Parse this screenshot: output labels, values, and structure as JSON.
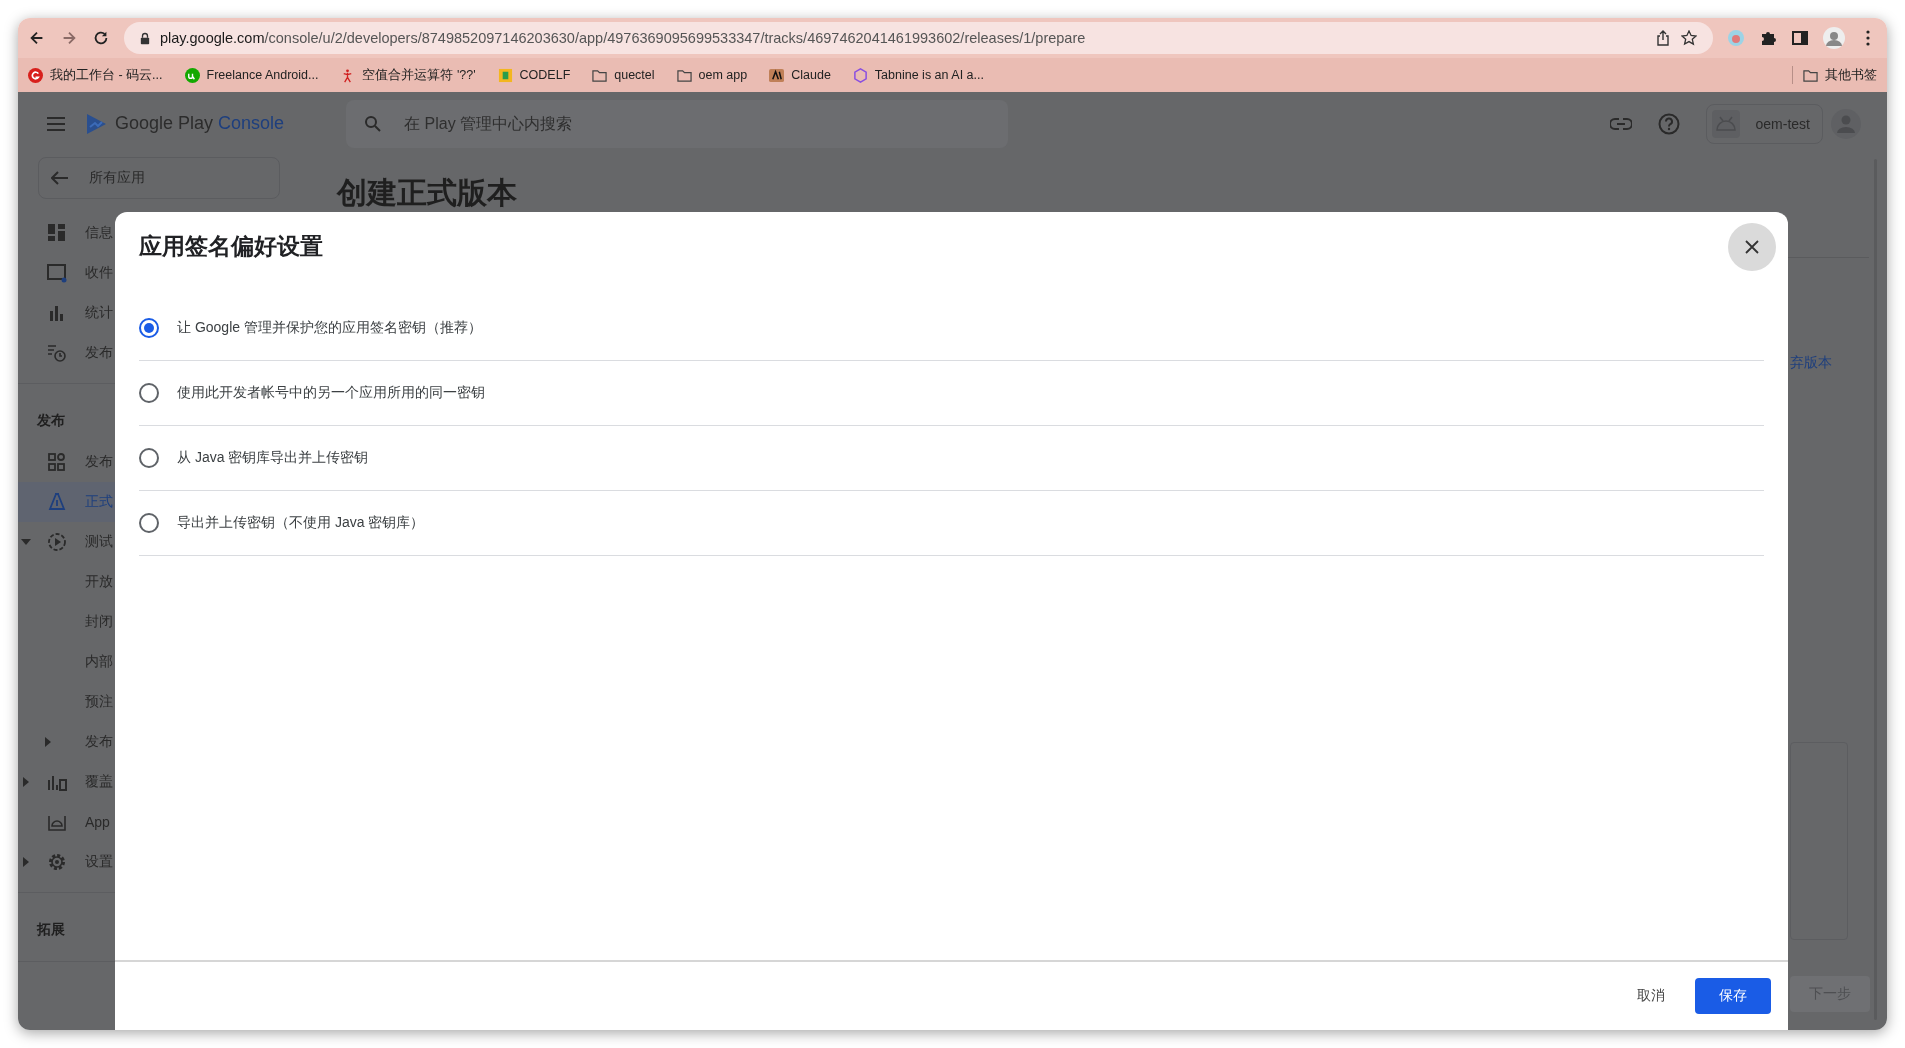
{
  "browser": {
    "url_host": "play.google.com",
    "url_path": "/console/u/2/developers/8749852097146203630/app/4976369095699533347/tracks/4697462041461993602/releases/1/prepare",
    "bookmarks": [
      {
        "label": "我的工作台 - 码云...",
        "kind": "redcircle"
      },
      {
        "label": "Freelance Android...",
        "kind": "greencircle"
      },
      {
        "label": "空值合并运算符 '??'",
        "kind": "figure"
      },
      {
        "label": "CODELF",
        "kind": "yellowsquare"
      },
      {
        "label": "quectel",
        "kind": "folder"
      },
      {
        "label": "oem app",
        "kind": "folder"
      },
      {
        "label": "Claude",
        "kind": "brownsquare"
      },
      {
        "label": "Tabnine is an AI a...",
        "kind": "purplehex"
      }
    ],
    "other_bookmarks": "其他书签"
  },
  "header": {
    "brand": "Google Play",
    "product": "Console",
    "search_placeholder": "在 Play 管理中心内搜索",
    "account": "oem-test"
  },
  "sidebar": {
    "back": "所有应用",
    "sections": [
      {
        "items": [
          {
            "label": "信息",
            "selected": false
          },
          {
            "label": "收件",
            "selected": false
          },
          {
            "label": "统计",
            "selected": false
          },
          {
            "label": "发布",
            "selected": false
          }
        ]
      },
      {
        "heading": "发布",
        "items": [
          {
            "label": "发布",
            "selected": false
          },
          {
            "label": "正式",
            "selected": true
          },
          {
            "label": "测试",
            "selected": false,
            "expanded": true,
            "children": [
              {
                "label": "开放",
                "selected": false
              },
              {
                "label": "封闭",
                "selected": false
              },
              {
                "label": "内部",
                "selected": false
              },
              {
                "label": "预注",
                "selected": false
              },
              {
                "label": "发布",
                "selected": false,
                "expanded": false
              }
            ]
          },
          {
            "label": "覆盖",
            "selected": false,
            "expanded": false
          },
          {
            "label": "App",
            "selected": false
          },
          {
            "label": "设置",
            "selected": false,
            "expanded": false
          }
        ]
      },
      {
        "heading": "拓展"
      }
    ]
  },
  "page": {
    "title": "创建正式版本",
    "link": "弃版本",
    "next_button": "下一步"
  },
  "dialog": {
    "title": "应用签名偏好设置",
    "options": [
      {
        "label": "让 Google 管理并保护您的应用签名密钥（推荐）",
        "selected": true
      },
      {
        "label": "使用此开发者帐号中的另一个应用所用的同一密钥",
        "selected": false
      },
      {
        "label": "从 Java 密钥库导出并上传密钥",
        "selected": false
      },
      {
        "label": "导出并上传密钥（不使用 Java 密钥库）",
        "selected": false
      }
    ],
    "cancel": "取消",
    "save": "保存"
  }
}
